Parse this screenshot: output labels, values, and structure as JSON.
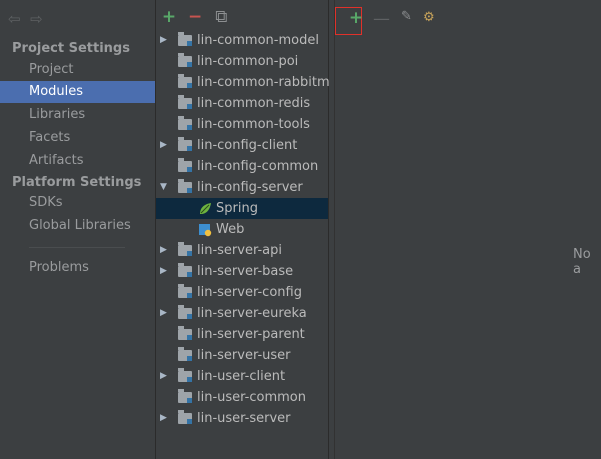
{
  "left": {
    "nav_back_icon": "back-arrow-icon",
    "nav_forward_icon": "forward-arrow-icon",
    "project_settings_header": "Project Settings",
    "project_items": [
      "Project",
      "Modules",
      "Libraries",
      "Facets",
      "Artifacts"
    ],
    "platform_settings_header": "Platform Settings",
    "platform_items": [
      "SDKs",
      "Global Libraries"
    ],
    "problems_item": "Problems",
    "selected_item": "Modules"
  },
  "mid": {
    "toolbar": {
      "add_icon": "plus-icon",
      "remove_icon": "minus-icon",
      "copy_icon": "copy-icon"
    },
    "tree": [
      {
        "label": "lin-common-model",
        "expandable": true
      },
      {
        "label": "lin-common-poi",
        "expandable": false
      },
      {
        "label": "lin-common-rabbitmq",
        "expandable": false
      },
      {
        "label": "lin-common-redis",
        "expandable": false
      },
      {
        "label": "lin-common-tools",
        "expandable": false
      },
      {
        "label": "lin-config-client",
        "expandable": true
      },
      {
        "label": "lin-config-common",
        "expandable": false
      },
      {
        "label": "lin-config-server",
        "expandable": true,
        "expanded": true
      },
      {
        "label": "Spring",
        "child": true,
        "icon": "spring-leaf-icon",
        "selected": true
      },
      {
        "label": "Web",
        "child": true,
        "icon": "web-icon"
      },
      {
        "label": "lin-server-api",
        "expandable": true
      },
      {
        "label": "lin-server-base",
        "expandable": true
      },
      {
        "label": "lin-server-config",
        "expandable": false
      },
      {
        "label": "lin-server-eureka",
        "expandable": true
      },
      {
        "label": "lin-server-parent",
        "expandable": false
      },
      {
        "label": "lin-server-user",
        "expandable": false
      },
      {
        "label": "lin-user-client",
        "expandable": true
      },
      {
        "label": "lin-user-common",
        "expandable": false
      },
      {
        "label": "lin-user-server",
        "expandable": true
      }
    ]
  },
  "right": {
    "toolbar": {
      "add_icon": "plus-icon",
      "remove_icon": "minus-icon",
      "edit_icon": "pencil-icon",
      "tools_icon": "tools-icon"
    },
    "empty_text": "No a"
  }
}
